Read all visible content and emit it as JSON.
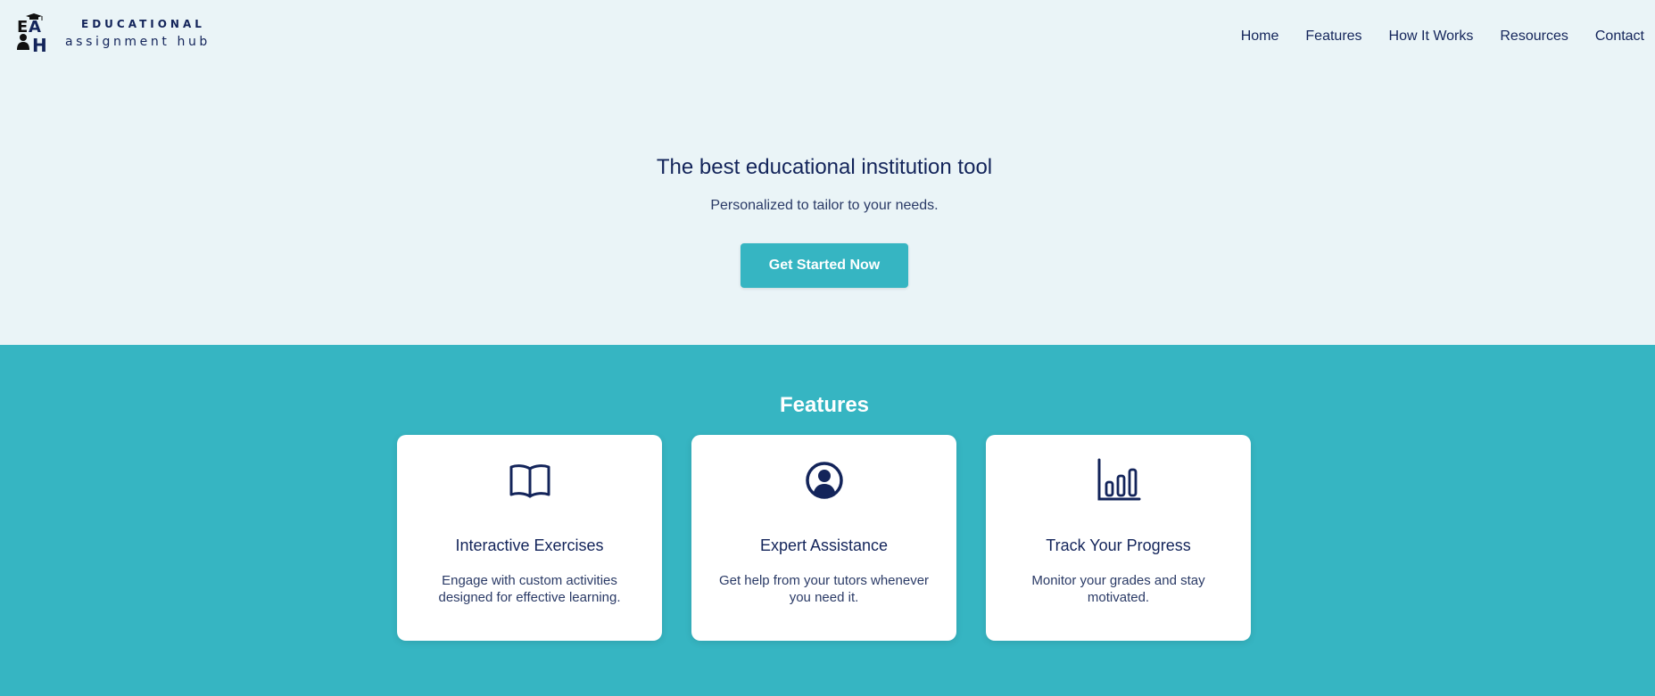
{
  "brand": {
    "name_top": "EDUCATIONAL",
    "name_bottom": "assignment hub",
    "mark_letters": [
      "E",
      "A",
      "H"
    ]
  },
  "nav": {
    "items": [
      {
        "label": "Home"
      },
      {
        "label": "Features"
      },
      {
        "label": "How It Works"
      },
      {
        "label": "Resources"
      },
      {
        "label": "Contact"
      }
    ]
  },
  "hero": {
    "title": "The best educational institution tool",
    "subtitle": "Personalized to tailor to your needs.",
    "cta_label": "Get Started Now"
  },
  "features": {
    "title": "Features",
    "cards": [
      {
        "icon": "open-book-icon",
        "title": "Interactive Exercises",
        "description": "Engage with custom activities designed for effective learning."
      },
      {
        "icon": "user-circle-icon",
        "title": "Expert Assistance",
        "description": "Get help from your tutors whenever you need it."
      },
      {
        "icon": "bar-chart-icon",
        "title": "Track Your Progress",
        "description": "Monitor your grades and stay motivated."
      }
    ]
  },
  "colors": {
    "navy": "#13245a",
    "teal": "#36b5c2",
    "background": "#eaf4f7",
    "card": "#ffffff"
  }
}
